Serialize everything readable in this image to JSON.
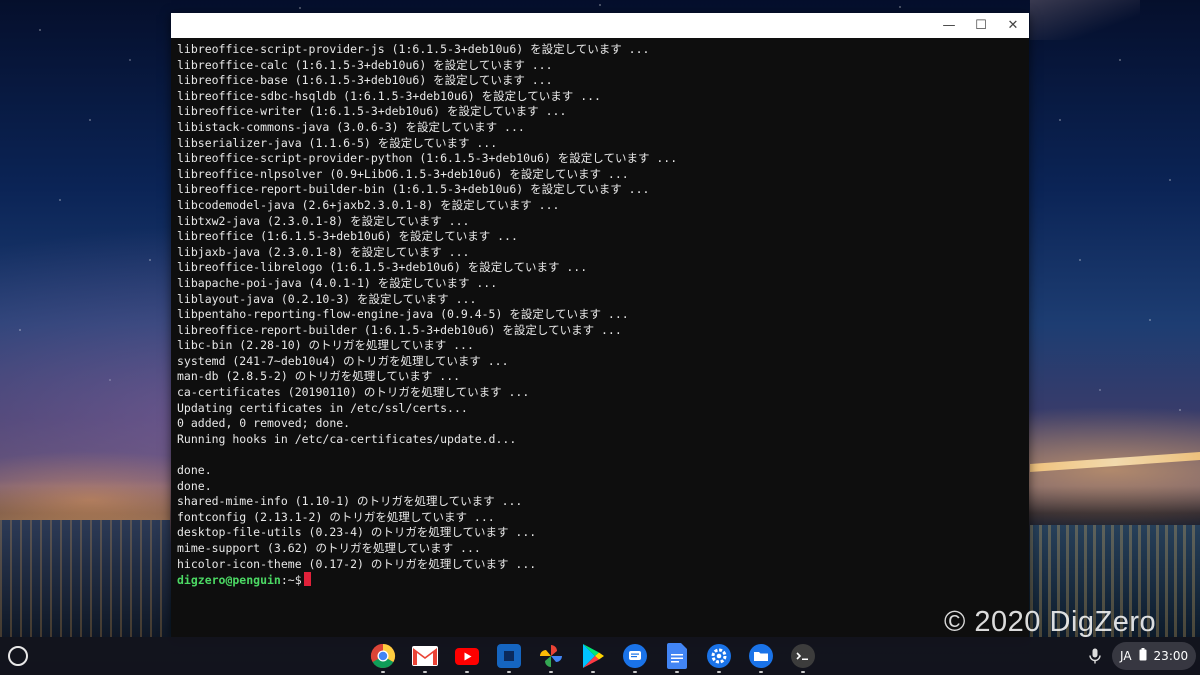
{
  "window": {
    "minimize_label": "—",
    "maximize_label": "☐",
    "close_label": "✕"
  },
  "terminal": {
    "lines": [
      "libreoffice-script-provider-js (1:6.1.5-3+deb10u6) を設定しています ...",
      "libreoffice-calc (1:6.1.5-3+deb10u6) を設定しています ...",
      "libreoffice-base (1:6.1.5-3+deb10u6) を設定しています ...",
      "libreoffice-sdbc-hsqldb (1:6.1.5-3+deb10u6) を設定しています ...",
      "libreoffice-writer (1:6.1.5-3+deb10u6) を設定しています ...",
      "libistack-commons-java (3.0.6-3) を設定しています ...",
      "libserializer-java (1.1.6-5) を設定しています ...",
      "libreoffice-script-provider-python (1:6.1.5-3+deb10u6) を設定しています ...",
      "libreoffice-nlpsolver (0.9+LibO6.1.5-3+deb10u6) を設定しています ...",
      "libreoffice-report-builder-bin (1:6.1.5-3+deb10u6) を設定しています ...",
      "libcodemodel-java (2.6+jaxb2.3.0.1-8) を設定しています ...",
      "libtxw2-java (2.3.0.1-8) を設定しています ...",
      "libreoffice (1:6.1.5-3+deb10u6) を設定しています ...",
      "libjaxb-java (2.3.0.1-8) を設定しています ...",
      "libreoffice-librelogo (1:6.1.5-3+deb10u6) を設定しています ...",
      "libapache-poi-java (4.0.1-1) を設定しています ...",
      "liblayout-java (0.2.10-3) を設定しています ...",
      "libpentaho-reporting-flow-engine-java (0.9.4-5) を設定しています ...",
      "libreoffice-report-builder (1:6.1.5-3+deb10u6) を設定しています ...",
      "libc-bin (2.28-10) のトリガを処理しています ...",
      "systemd (241-7~deb10u4) のトリガを処理しています ...",
      "man-db (2.8.5-2) のトリガを処理しています ...",
      "ca-certificates (20190110) のトリガを処理しています ...",
      "Updating certificates in /etc/ssl/certs...",
      "0 added, 0 removed; done.",
      "Running hooks in /etc/ca-certificates/update.d...",
      "",
      "done.",
      "done.",
      "shared-mime-info (1.10-1) のトリガを処理しています ...",
      "fontconfig (2.13.1-2) のトリガを処理しています ...",
      "desktop-file-utils (0.23-4) のトリガを処理しています ...",
      "mime-support (3.62) のトリガを処理しています ...",
      "hicolor-icon-theme (0.17-2) のトリガを処理しています ..."
    ],
    "prompt_user": "digzero@penguin",
    "prompt_path": ":~$"
  },
  "watermark": "© 2020 DigZero",
  "shelf": {
    "apps": [
      {
        "name": "chrome-icon",
        "color": "#4285f4"
      },
      {
        "name": "gmail-icon",
        "color": "#ea4335"
      },
      {
        "name": "youtube-icon",
        "color": "#ff0000"
      },
      {
        "name": "app-square-icon",
        "color": "#1565c0"
      },
      {
        "name": "photos-icon",
        "color": "#fbbc05"
      },
      {
        "name": "play-store-icon",
        "color": "#01875f"
      },
      {
        "name": "messages-icon",
        "color": "#1a73e8"
      },
      {
        "name": "docs-icon",
        "color": "#4285f4"
      },
      {
        "name": "settings-icon",
        "color": "#1a73e8"
      },
      {
        "name": "files-icon",
        "color": "#1a73e8"
      },
      {
        "name": "terminal-icon",
        "color": "#3c3c3c"
      }
    ],
    "ime": "JA",
    "time": "23:00"
  }
}
